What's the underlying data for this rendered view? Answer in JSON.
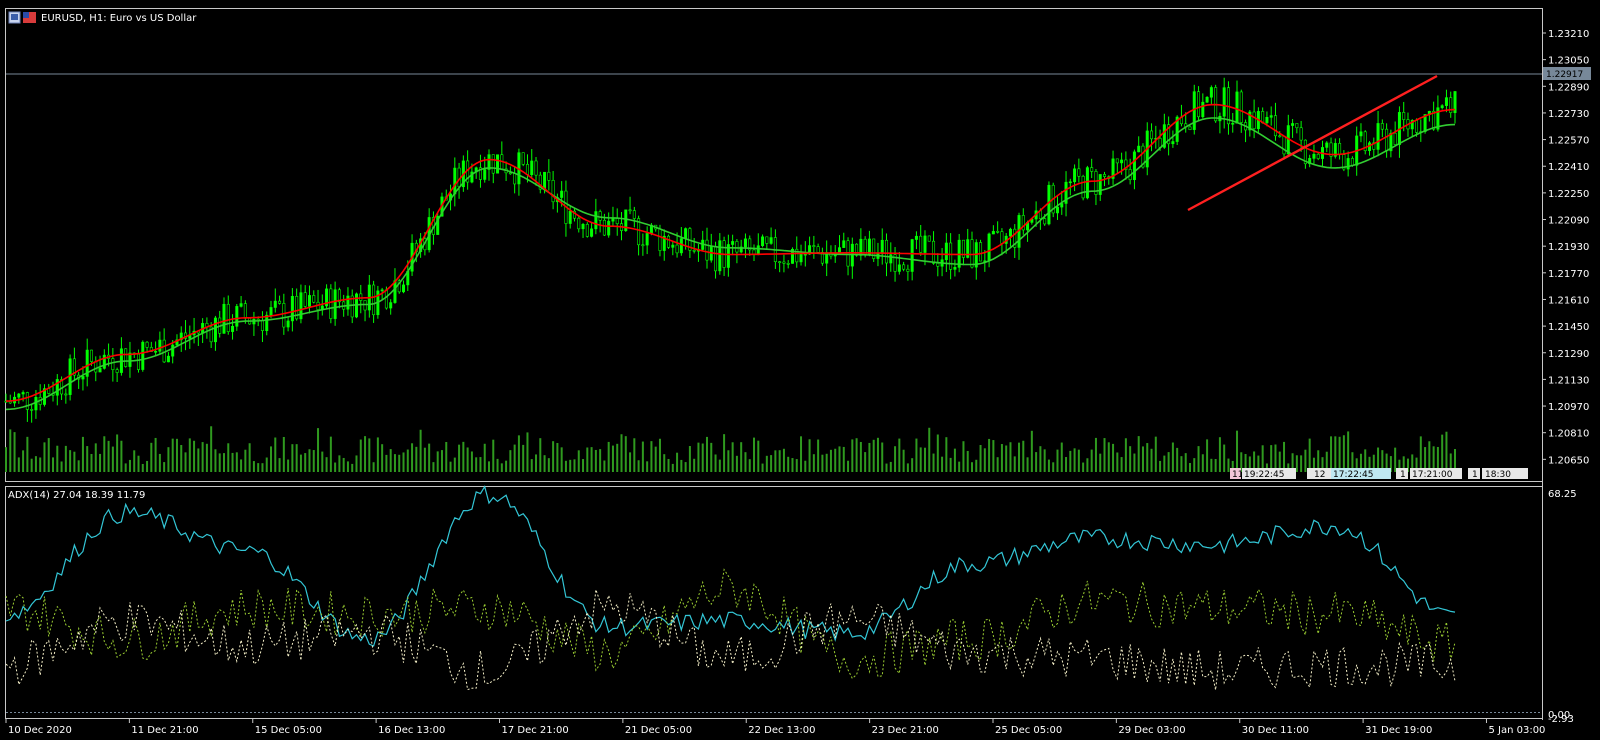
{
  "colors": {
    "background": "#000000",
    "frame": "#c8c8c8",
    "bull_candle": "#00ff00",
    "volume": "#2f9a1f",
    "ma_fast": "#ff0000",
    "ma_slow": "#32cd32",
    "trendline": "#ff2020",
    "bid_line": "#778899",
    "adx": "#33c6d6",
    "plus_di": "#9acd32",
    "minus_di": "#f5f0c8"
  },
  "header": {
    "icons": [
      "window-restore-icon",
      "symbol-flag-icon"
    ],
    "title": "EURUSD, H1:  Euro vs US Dollar"
  },
  "price_axis": {
    "labels": [
      "1.23210",
      "1.23050",
      "1.22890",
      "1.22730",
      "1.22570",
      "1.22410",
      "1.22250",
      "1.22090",
      "1.21930",
      "1.21770",
      "1.21610",
      "1.21450",
      "1.21290",
      "1.21130",
      "1.20970",
      "1.20810",
      "1.20650"
    ],
    "current_price": "1.22917"
  },
  "indicator": {
    "label": "ADX(14) 27.04 18.39 11.79",
    "axis_top": "68.25",
    "axis_bottom": "0.00",
    "axis_edge": "-2.93"
  },
  "time_axis": {
    "labels": [
      "10 Dec 2020",
      "11 Dec 21:00",
      "15 Dec 05:00",
      "16 Dec 13:00",
      "17 Dec 21:00",
      "21 Dec 05:00",
      "22 Dec 13:00",
      "23 Dec 21:00",
      "25 Dec 05:00",
      "29 Dec 03:00",
      "30 Dec 11:00",
      "31 Dec 19:00",
      "5 Jan 03:00"
    ]
  },
  "scale_tags": [
    "11",
    "19:22:45",
    "12",
    "17:22:45",
    "1",
    "17:21:00",
    "1",
    "18:30"
  ],
  "chart_data": [
    {
      "type": "line",
      "subtype": "candlestick",
      "title": "EURUSD, H1:  Euro vs US Dollar",
      "x": [
        "10 Dec 2020",
        "11 Dec 21:00",
        "15 Dec 05:00",
        "16 Dec 13:00",
        "17 Dec 21:00",
        "21 Dec 05:00",
        "22 Dec 13:00",
        "23 Dec 21:00",
        "25 Dec 05:00",
        "29 Dec 03:00",
        "30 Dec 11:00",
        "31 Dec 19:00",
        "5 Jan 03:00"
      ],
      "ylim": [
        1.2058,
        1.233
      ],
      "series": [
        {
          "values": [
            1.21,
            1.2128,
            1.215,
            1.2162,
            1.2245,
            1.2205,
            1.2188,
            1.2189,
            1.2188,
            1.2232,
            1.2278,
            1.2248,
            1.2275
          ]
        },
        {
          "values": [
            1.2095,
            1.2124,
            1.2148,
            1.2158,
            1.224,
            1.221,
            1.2192,
            1.2188,
            1.2182,
            1.2226,
            1.227,
            1.224,
            1.2266
          ]
        }
      ],
      "trendline": {
        "from": [
          "31 Dec 19:00",
          1.2209
        ],
        "to": [
          "5 Jan 03:00",
          1.2293
        ]
      },
      "current_price": 1.22917,
      "grid": false
    },
    {
      "type": "line",
      "title": "ADX(14) 27.04 18.39 11.79",
      "x": [
        "10 Dec 2020",
        "11 Dec 21:00",
        "15 Dec 05:00",
        "16 Dec 13:00",
        "17 Dec 21:00",
        "21 Dec 05:00",
        "22 Dec 13:00",
        "23 Dec 21:00",
        "25 Dec 05:00",
        "29 Dec 03:00",
        "30 Dec 11:00",
        "31 Dec 19:00",
        "5 Jan 03:00"
      ],
      "ylim": [
        -2.93,
        68.25
      ],
      "series": [
        {
          "values": [
            28,
            60,
            48,
            20,
            66,
            24,
            26,
            22,
            44,
            52,
            50,
            56,
            27.04
          ]
        },
        {
          "values": [
            30,
            20,
            30,
            28,
            30,
            16,
            36,
            14,
            20,
            32,
            30,
            28,
            18.39
          ]
        },
        {
          "values": [
            12,
            26,
            18,
            22,
            10,
            30,
            14,
            26,
            16,
            14,
            10,
            12,
            11.79
          ]
        }
      ],
      "grid": false
    }
  ]
}
